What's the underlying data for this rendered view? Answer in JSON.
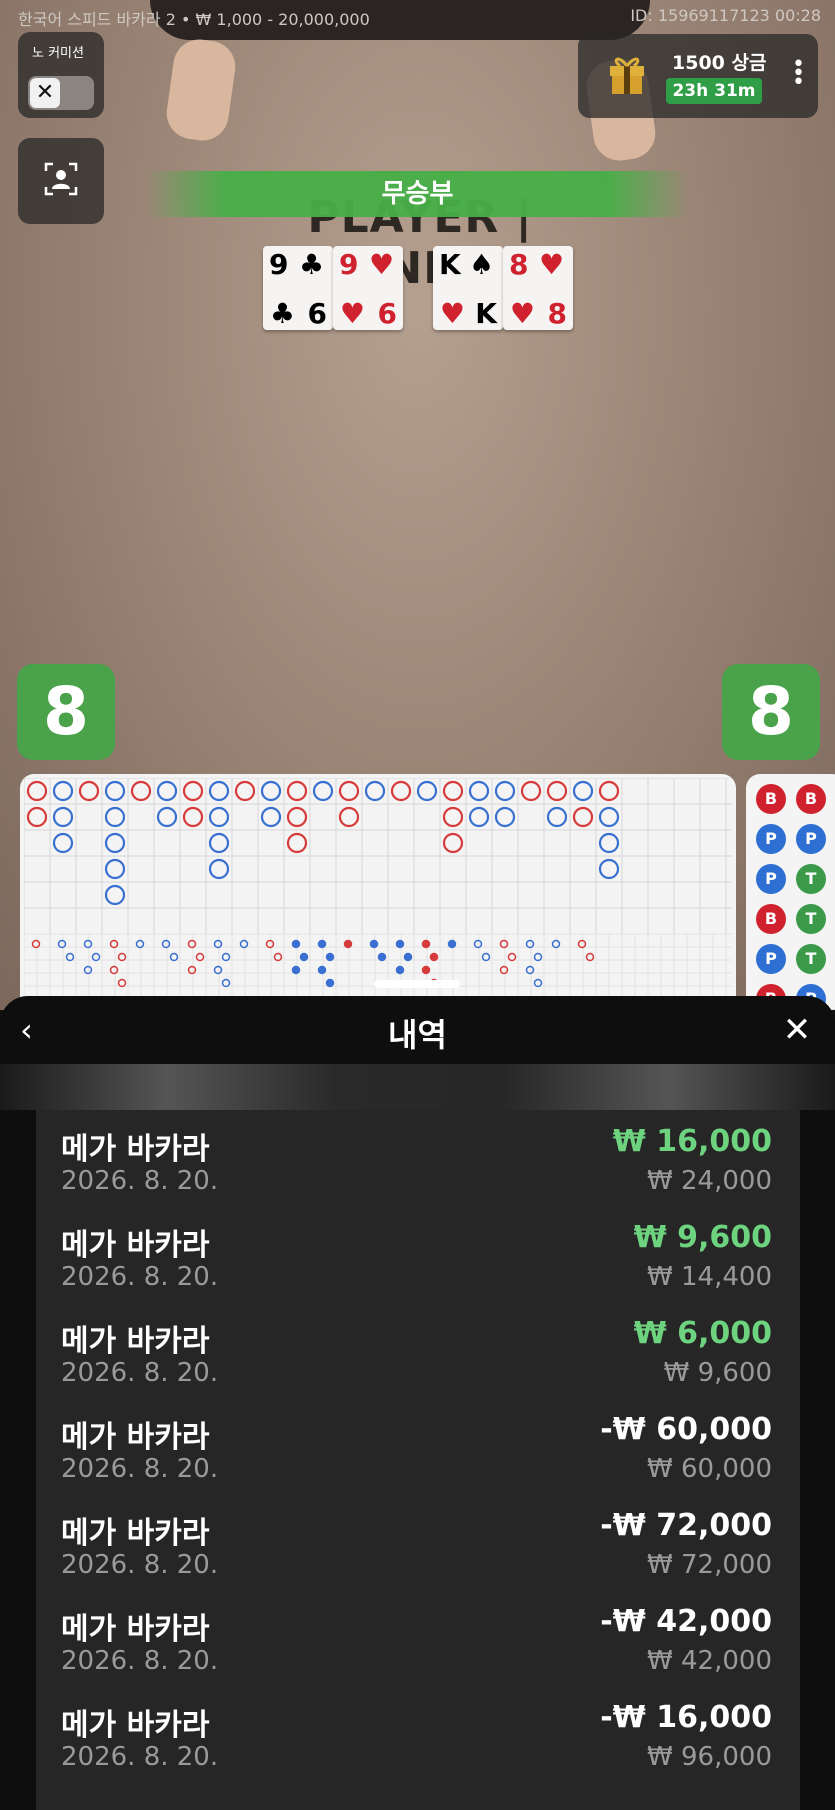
{
  "top_bar": {
    "table_info": "한국어 스피드 바카라 2 • ₩ 1,000 - 20,000,000",
    "session_info": "ID: 15969117123 00:28"
  },
  "no_commission": {
    "label": "노 커미션",
    "toggle_icon": "✕"
  },
  "promo": {
    "title": "1500 상금",
    "timer": "23h 31m"
  },
  "result": {
    "banner": "무승부"
  },
  "table": {
    "label": "PLAYER | BANKER"
  },
  "cards": {
    "player": [
      {
        "rank": "9",
        "suit": "♣",
        "rank2": "6",
        "suit2": "♣",
        "color": "#151515"
      },
      {
        "rank": "9",
        "suit": "♥",
        "rank2": "6",
        "suit2": "♥",
        "color": "#d0212f"
      }
    ],
    "banker": [
      {
        "rank": "K",
        "suit": "♠",
        "rank2": "K",
        "suit2": "♥",
        "color": "#151515"
      },
      {
        "rank": "8",
        "suit": "♥",
        "rank2": "8",
        "suit2": "♥",
        "color": "#d0212f"
      }
    ]
  },
  "scores": {
    "player": "8",
    "banker": "8"
  },
  "predict": {
    "chips": [
      [
        "B",
        "B"
      ],
      [
        "P",
        "P"
      ],
      [
        "P",
        "T"
      ],
      [
        "B",
        "T"
      ],
      [
        "P",
        "T"
      ],
      [
        "B",
        "P"
      ]
    ]
  },
  "history": {
    "title": "내역",
    "rows": [
      {
        "name": "메가 바카라",
        "date": "2026. 8. 20.",
        "amount": "₩ 16,000",
        "bet": "₩ 24,000",
        "win": true
      },
      {
        "name": "메가 바카라",
        "date": "2026. 8. 20.",
        "amount": "₩ 9,600",
        "bet": "₩ 14,400",
        "win": true
      },
      {
        "name": "메가 바카라",
        "date": "2026. 8. 20.",
        "amount": "₩ 6,000",
        "bet": "₩ 9,600",
        "win": true
      },
      {
        "name": "메가 바카라",
        "date": "2026. 8. 20.",
        "amount": "-₩ 60,000",
        "bet": "₩ 60,000",
        "win": false
      },
      {
        "name": "메가 바카라",
        "date": "2026. 8. 20.",
        "amount": "-₩ 72,000",
        "bet": "₩ 72,000",
        "win": false
      },
      {
        "name": "메가 바카라",
        "date": "2026. 8. 20.",
        "amount": "-₩ 42,000",
        "bet": "₩ 42,000",
        "win": false
      },
      {
        "name": "메가 바카라",
        "date": "2026. 8. 20.",
        "amount": "-₩ 16,000",
        "bet": "₩ 96,000",
        "win": false
      }
    ]
  },
  "colors": {
    "win": "#6ed37f",
    "player_blue": "#2d6fd2",
    "banker_red": "#d0212f",
    "tie_green": "#3a9a4a",
    "accent_green": "#4aa24a"
  },
  "icons": {
    "back": "chevron-left-icon",
    "close": "close-icon",
    "gift": "gift-icon",
    "person": "person-frame-icon",
    "menu": "kebab-menu-icon"
  }
}
